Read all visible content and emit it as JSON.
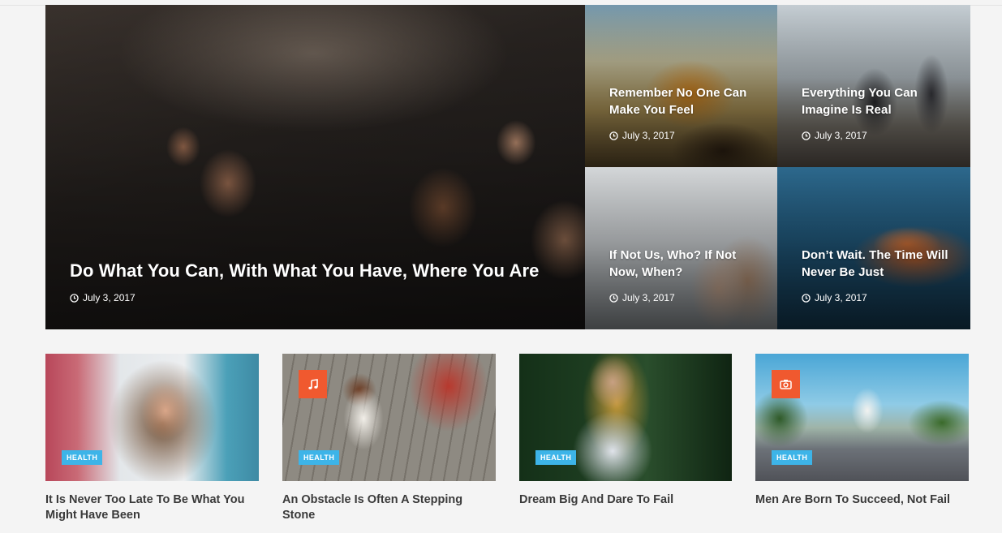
{
  "featured": {
    "main": {
      "title": "Do What You Can, With What You Have, Where You Are",
      "date": "July 3, 2017"
    },
    "side": [
      {
        "title": "Remember No One Can Make You Feel",
        "date": "July 3, 2017"
      },
      {
        "title": "Everything You Can Imagine Is Real",
        "date": "July 3, 2017"
      },
      {
        "title": "If Not Us, Who? If Not Now, When?",
        "date": "July 3, 2017"
      },
      {
        "title": "Don’t Wait. The Time Will Never Be Just",
        "date": "July 3, 2017"
      }
    ]
  },
  "cards": [
    {
      "category": "HEALTH",
      "title": "It Is Never Too Late To Be What You Might Have Been",
      "format_icon": ""
    },
    {
      "category": "HEALTH",
      "title": "An Obstacle Is Often A Stepping Stone",
      "format_icon": "music-icon"
    },
    {
      "category": "HEALTH",
      "title": "Dream Big And Dare To Fail",
      "format_icon": ""
    },
    {
      "category": "HEALTH",
      "title": "Men Are Born To Succeed, Not Fail",
      "format_icon": "camera-icon"
    }
  ],
  "colors": {
    "badge": "#3db4e8",
    "format_box": "#f0592f",
    "card_title": "#3a3a3a"
  }
}
